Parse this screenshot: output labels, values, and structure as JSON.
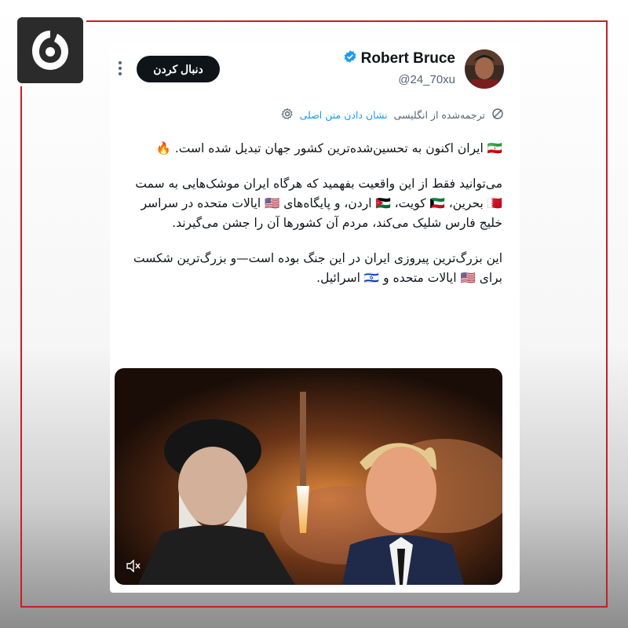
{
  "author": {
    "name": "Robert Bruce",
    "handle": "@24_70xu",
    "verified": true
  },
  "follow_button": {
    "label": "دنبال کردن"
  },
  "translation": {
    "label": "ترجمه‌شده از انگلیسی",
    "show_original": "نشان دادن متن اصلی"
  },
  "tweet": {
    "paragraphs": [
      "🇮🇷 ایران اکنون به تحسین‌شده‌ترین کشور جهان تبدیل شده است. 🔥",
      "می‌توانید فقط از این واقعیت بفهمید که هرگاه ایران موشک‌هایی به سمت 🇧🇭 بحرین، 🇰🇼 کویت، 🇯🇴 اردن، و پایگاه‌های 🇺🇸 ایالات متحده در سراسر خلیج فارس شلیک می‌کند، مردم آن کشورها آن را جشن می‌گیرند.",
      "این بزرگ‌ترین پیروزی ایران در این جنگ بوده است—و بزرگ‌ترین شکست برای 🇺🇸 ایالات متحده و 🇮🇱 اسرائیل."
    ]
  },
  "icons": {
    "logo": "channel-logo-icon",
    "verified": "verified-badge-icon",
    "more": "more-options-icon",
    "translate": "translate-icon",
    "settings": "gear-icon",
    "mute": "mute-icon"
  },
  "colors": {
    "accent": "#1d9bf0",
    "frame": "#c3202a",
    "button": "#0f1419"
  }
}
